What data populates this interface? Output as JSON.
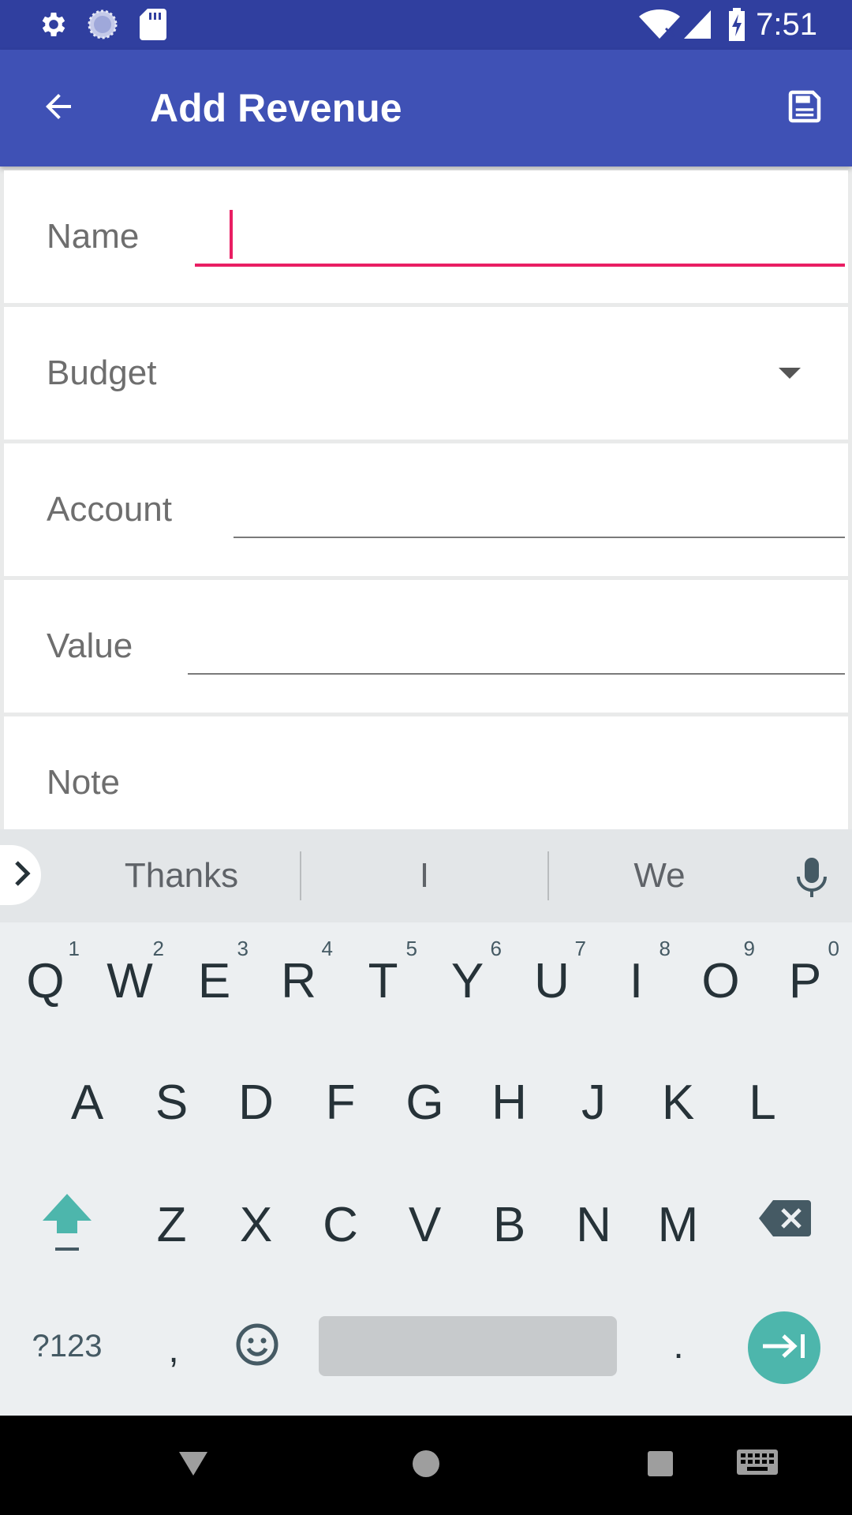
{
  "status_bar": {
    "time": "7:51",
    "icons": [
      "gear-icon",
      "sync-icon",
      "sd-card-icon",
      "wifi-icon",
      "signal-icon",
      "battery-charging-icon"
    ]
  },
  "app_bar": {
    "title": "Add Revenue",
    "back_icon": "arrow-left-icon",
    "save_icon": "floppy-disk-icon"
  },
  "form": {
    "name": {
      "label": "Name",
      "value": "",
      "focused": true
    },
    "budget": {
      "label": "Budget",
      "selected": ""
    },
    "account": {
      "label": "Account",
      "value": ""
    },
    "value": {
      "label": "Value",
      "value": ""
    },
    "note": {
      "label": "Note",
      "value": ""
    }
  },
  "keyboard": {
    "suggestions": [
      "Thanks",
      "I",
      "We"
    ],
    "row1": [
      {
        "key": "Q",
        "hint": "1"
      },
      {
        "key": "W",
        "hint": "2"
      },
      {
        "key": "E",
        "hint": "3"
      },
      {
        "key": "R",
        "hint": "4"
      },
      {
        "key": "T",
        "hint": "5"
      },
      {
        "key": "Y",
        "hint": "6"
      },
      {
        "key": "U",
        "hint": "7"
      },
      {
        "key": "I",
        "hint": "8"
      },
      {
        "key": "O",
        "hint": "9"
      },
      {
        "key": "P",
        "hint": "0"
      }
    ],
    "row2": [
      "A",
      "S",
      "D",
      "F",
      "G",
      "H",
      "J",
      "K",
      "L"
    ],
    "row3": [
      "Z",
      "X",
      "C",
      "V",
      "B",
      "N",
      "M"
    ],
    "symbols_label": "?123",
    "comma": ",",
    "period": ".",
    "accent_color": "#4db6ac"
  },
  "colors": {
    "primary": "#3f51b5",
    "primary_dark": "#303f9f",
    "accent": "#e91e63"
  }
}
